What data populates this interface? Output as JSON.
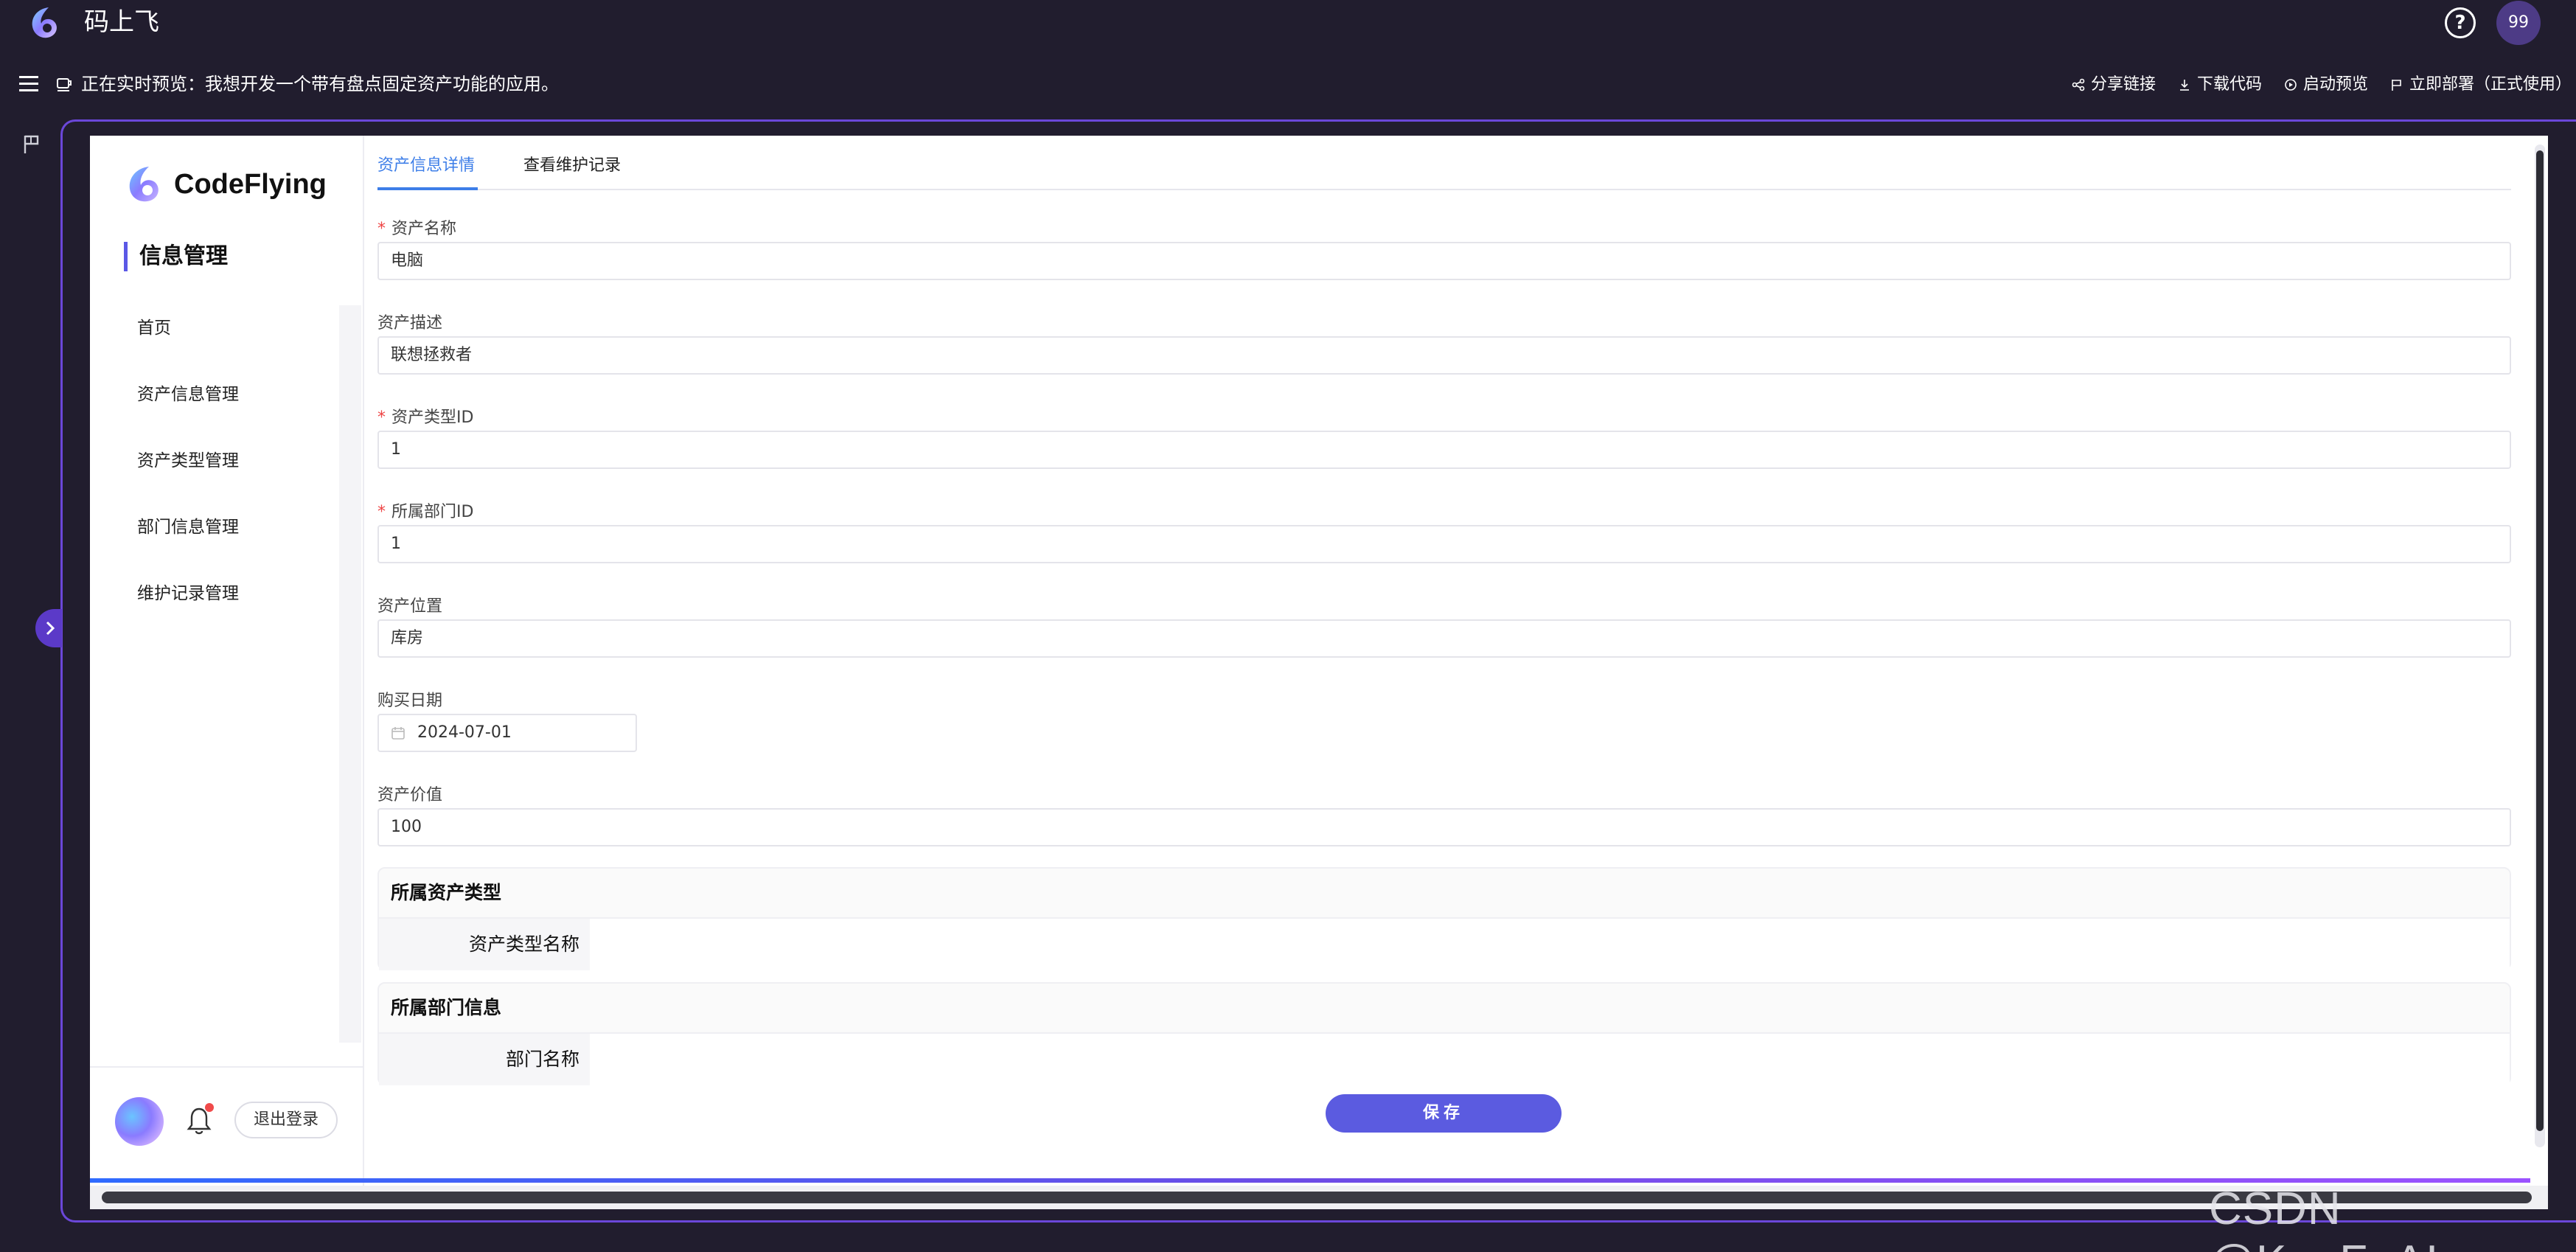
{
  "topbar": {
    "app_title": "码上飞",
    "help_label": "?",
    "badge_count": "99"
  },
  "previewbar": {
    "text": "正在实时预览：我想开发一个带有盘点固定资产功能的应用。",
    "actions": [
      {
        "label": "分享链接",
        "icon": "share-icon"
      },
      {
        "label": "下载代码",
        "icon": "download-icon"
      },
      {
        "label": "启动预览",
        "icon": "play-icon"
      },
      {
        "label": "立即部署（正式使用）",
        "icon": "flag-icon"
      }
    ]
  },
  "sidebar": {
    "brand": "CodeFlying",
    "section_title": "信息管理",
    "items": [
      {
        "label": "首页"
      },
      {
        "label": "资产信息管理"
      },
      {
        "label": "资产类型管理"
      },
      {
        "label": "部门信息管理"
      },
      {
        "label": "维护记录管理"
      }
    ],
    "logout_label": "退出登录"
  },
  "tabs": [
    {
      "label": "资产信息详情",
      "active": true
    },
    {
      "label": "查看维护记录",
      "active": false
    }
  ],
  "form": {
    "asset_name": {
      "label": "资产名称",
      "required": "*",
      "value": "电脑"
    },
    "asset_desc": {
      "label": "资产描述",
      "value": "联想拯救者"
    },
    "asset_type_id": {
      "label": "资产类型ID",
      "required": "*",
      "value": "1"
    },
    "department_id": {
      "label": "所属部门ID",
      "required": "*",
      "value": "1"
    },
    "asset_location": {
      "label": "资产位置",
      "value": "库房"
    },
    "purchase_date": {
      "label": "购买日期",
      "value": "2024-07-01"
    },
    "asset_value": {
      "label": "资产价值",
      "value": "100"
    }
  },
  "descriptions": [
    {
      "title": "所属资产类型",
      "key": "资产类型名称",
      "value": ""
    },
    {
      "title": "所属部门信息",
      "key": "部门名称",
      "value": ""
    }
  ],
  "save_label": "保存",
  "watermark": "CSDN @KuaFuAI",
  "colors": {
    "background": "#211d2e",
    "accent": "#5b5be0",
    "tab_active": "#3d7ee8",
    "frame_border": "#6b47d9",
    "required": "#ee4444"
  }
}
